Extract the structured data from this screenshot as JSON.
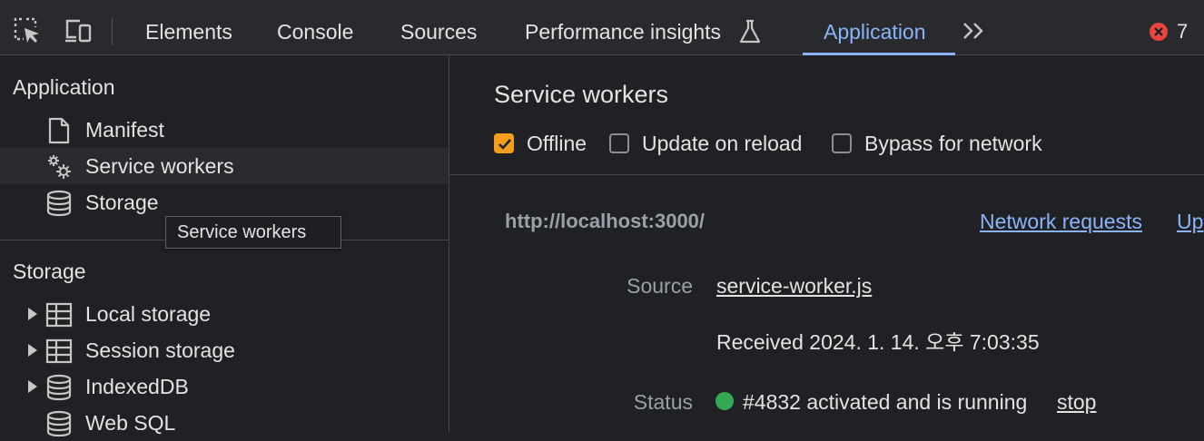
{
  "toolbar": {
    "tabs": [
      {
        "label": "Elements"
      },
      {
        "label": "Console"
      },
      {
        "label": "Sources"
      },
      {
        "label": "Performance insights"
      },
      {
        "label": "Application"
      }
    ],
    "active_tab": "Application",
    "error_count": "7",
    "icons": [
      "inspect-element-icon",
      "device-toggle-icon",
      "flask-icon",
      "more-tabs-icon",
      "error-icon"
    ],
    "colors": {
      "accent": "#8ab4f8",
      "error": "#e8453c"
    }
  },
  "sidebar": {
    "application_section": {
      "title": "Application",
      "items": [
        {
          "label": "Manifest",
          "icon": "file-icon"
        },
        {
          "label": "Service workers",
          "icon": "gears-icon",
          "selected": true
        },
        {
          "label": "Storage",
          "icon": "database-icon"
        }
      ]
    },
    "tooltip": "Service workers",
    "storage_section": {
      "title": "Storage",
      "items": [
        {
          "label": "Local storage",
          "icon": "table-icon"
        },
        {
          "label": "Session storage",
          "icon": "table-icon"
        },
        {
          "label": "IndexedDB",
          "icon": "database-icon"
        },
        {
          "label": "Web SQL",
          "icon": "database-icon"
        }
      ]
    }
  },
  "main": {
    "title": "Service workers",
    "options": [
      {
        "label": "Offline",
        "checked": true
      },
      {
        "label": "Update on reload",
        "checked": false
      },
      {
        "label": "Bypass for network",
        "checked": false
      }
    ],
    "worker": {
      "origin": "http://localhost:3000/",
      "network_requests_link": "Network requests",
      "update_link_partial": "Up",
      "source_label": "Source",
      "source_file": "service-worker.js",
      "received": "Received 2024. 1. 14. 오후 7:03:35",
      "status_label": "Status",
      "status_text": "#4832 activated and is running",
      "stop_link": "stop",
      "status_color": "#34a853"
    },
    "colors": {
      "checkbox_checked": "#f59e1b"
    }
  }
}
